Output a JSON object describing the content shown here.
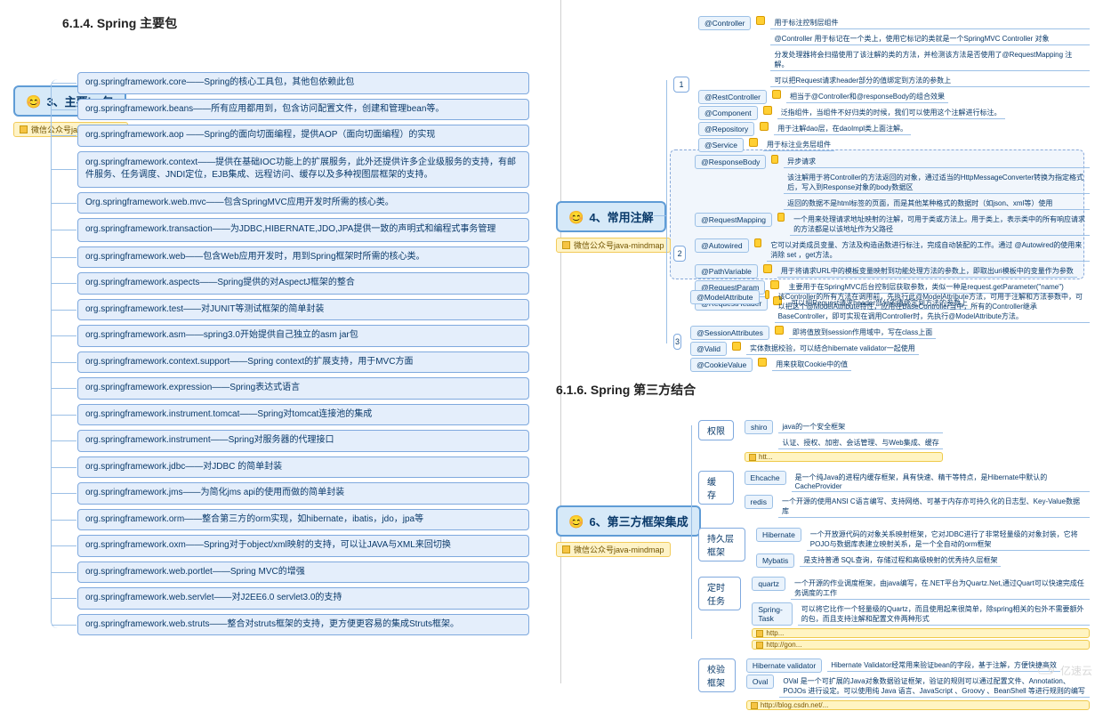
{
  "headings": {
    "h614": "6.1.4.  Spring 主要包",
    "h616": "6.1.6.  Spring 第三方结合"
  },
  "left": {
    "root": "3、主要jar包",
    "caption": "微信公众号java-mindmap",
    "items": [
      "org.springframework.core——Spring的核心工具包，其他包依赖此包",
      "org.springframework.beans——所有应用都用到，包含访问配置文件，创建和管理bean等。",
      "org.springframework.aop ——Spring的面向切面编程，提供AOP（面向切面编程）的实现",
      "org.springframework.context——提供在基础IOC功能上的扩展服务，此外还提供许多企业级服务的支持，有邮件服务、任务调度、JNDI定位，EJB集成、远程访问、缓存以及多种视图层框架的支持。",
      "Org.springframework.web.mvc——包含SpringMVC应用开发时所需的核心类。",
      "org.springframework.transaction——为JDBC,HIBERNATE,JDO,JPA提供一致的声明式和编程式事务管理",
      "org.springframework.web——包含Web应用开发时，用到Spring框架时所需的核心类。",
      "org.springframework.aspects——Spring提供的对AspectJ框架的整合",
      "org.springframework.test——对JUNIT等测试框架的简单封装",
      "org.springframework.asm——spring3.0开始提供自己独立的asm jar包",
      "org.springframework.context.support——Spring context的扩展支持，用于MVC方面",
      "org.springframework.expression——Spring表达式语言",
      "org.springframework.instrument.tomcat——Spring对tomcat连接池的集成",
      "org.springframework.instrument——Spring对服务器的代理接口",
      "org.springframework.jdbc——对JDBC 的简单封装",
      "org.springframework.jms——为简化jms api的使用而做的简单封装",
      "org.springframework.orm——整合第三方的orm实现，如hibernate，ibatis，jdo，jpa等",
      "org.springframework.oxm——Spring对于object/xml映射的支持，可以让JAVA与XML来回切换",
      "org.springframework.web.portlet——Spring MVC的增强",
      "org.springframework.web.servlet——对J2EE6.0 servlet3.0的支持",
      "org.springframework.web.struts——整合对struts框架的支持，更方便更容易的集成Struts框架。"
    ]
  },
  "ann": {
    "root": "4、常用注解",
    "caption": "微信公众号java-mindmap",
    "group1": {
      "num": "1",
      "rows": [
        {
          "k": "@Controller",
          "v": [
            "用于标注控制层组件",
            "@Controller 用于标记在一个类上，使用它标记的类就是一个SpringMVC Controller 对象",
            "分发处理器将会扫描使用了该注解的类的方法，并检测该方法是否使用了@RequestMapping 注解。",
            "可以把Request请求header部分的值绑定到方法的参数上"
          ]
        },
        {
          "k": "@RestController",
          "v": [
            "相当于@Controller和@responseBody的组合效果"
          ]
        },
        {
          "k": "@Component",
          "v": [
            "泛指组件，当组件不好归类的时候，我们可以使用这个注解进行标注。"
          ]
        },
        {
          "k": "@Repository",
          "v": [
            "用于注解dao层，在daoImpl类上面注解。"
          ]
        },
        {
          "k": "@Service",
          "v": [
            "用于标注业务层组件"
          ]
        }
      ]
    },
    "group2": {
      "num": "2",
      "rows": [
        {
          "k": "@ResponseBody",
          "v": [
            "异步请求",
            "该注解用于将Controller的方法返回的对象，通过适当的HttpMessageConverter转换为指定格式后，写入到Response对象的body数据区",
            "返回的数据不是html标签的页面，而是其他某种格式的数据时（如json、xml等）使用"
          ]
        },
        {
          "k": "@RequestMapping",
          "v": [
            "一个用来处理请求地址映射的注解，可用于类或方法上。用于类上，表示类中的所有响应请求的方法都是以该地址作为父路径"
          ]
        },
        {
          "k": "@Autowired",
          "v": [
            "它可以对类成员变量、方法及构造函数进行标注，完成自动装配的工作。通过 @Autowired的使用来消除 set ，get方法。"
          ]
        },
        {
          "k": "@PathVariable",
          "v": [
            "用于将请求URL中的模板变量映射到功能处理方法的参数上，即取出uri模板中的变量作为参数"
          ]
        },
        {
          "k": "@RequestParam",
          "v": [
            "主要用于在SpringMVC后台控制层获取参数，类似一种是request.getParameter(\"name\")"
          ]
        },
        {
          "k": "@RequestHeader",
          "v": [
            "可以把Request请求header部分的值绑定到方法的参数上"
          ]
        }
      ]
    },
    "group3": {
      "num": "3",
      "rows": [
        {
          "k": "@ModelAttribute",
          "v": [
            "该Controller的所有方法在调用前，先执行此@ModelAttribute方法，可用于注解和方法参数中，可以把这个@ModelAttribute特性，应用在BaseController当中，所有的Controller继承BaseController，即可实现在调用Controller时，先执行@ModelAttribute方法。"
          ]
        },
        {
          "k": "@SessionAttributes",
          "v": [
            "即将值放到session作用域中，写在class上面"
          ]
        },
        {
          "k": "@Valid",
          "v": [
            "实体数据校验，可以结合hibernate validator一起使用"
          ]
        },
        {
          "k": "@CookieValue",
          "v": [
            "用来获取Cookie中的值"
          ]
        }
      ]
    }
  },
  "tp": {
    "root": "6、第三方框架集成",
    "caption": "微信公众号java-mindmap",
    "cats": [
      {
        "name": "权限",
        "items": [
          {
            "k": "shiro",
            "v": "java的一个安全框架",
            "sub": "认证、授权、加密、会话管理、与Web集成、缓存"
          }
        ],
        "tags": [
          "htt..."
        ]
      },
      {
        "name": "缓存",
        "items": [
          {
            "k": "Ehcache",
            "v": "是一个纯Java的进程内缓存框架，具有快速、精干等特点，是Hibernate中默认的CacheProvider"
          },
          {
            "k": "redis",
            "v": "一个开源的使用ANSI C语言编写、支持网络、可基于内存亦可持久化的日志型、Key-Value数据库"
          }
        ]
      },
      {
        "name": "持久层框架",
        "items": [
          {
            "k": "Hibernate",
            "v": "一个开放源代码的对象关系映射框架，它对JDBC进行了非常轻量级的对象封装，它将POJO与数据库表建立映射关系，是一个全自动的orm框架"
          },
          {
            "k": "Mybatis",
            "v": "是支持普通 SQL查询，存储过程和高级映射的优秀持久层框架"
          }
        ]
      },
      {
        "name": "定时任务",
        "items": [
          {
            "k": "quartz",
            "v": "一个开源的作业调度框架，由java编写，在.NET平台为Quartz.Net,通过Quart可以快速完成任务调度的工作"
          },
          {
            "k": "Spring-Task",
            "v": "可以将它比作一个轻量级的Quartz，而且使用起来很简单，除spring相关的包外不需要额外的包，而且支持注解和配置文件两种形式"
          }
        ],
        "tags": [
          "http...",
          "http://gon..."
        ]
      },
      {
        "name": "校验框架",
        "items": [
          {
            "k": "Hibernate validator",
            "v": "Hibernate Validator经常用来验证bean的字段，基于注解，方便快捷高效"
          },
          {
            "k": "Oval",
            "v": "OVal 是一个可扩展的Java对象数据验证框架，验证的规则可以通过配置文件、Annotation、POJOs 进行设定。可以使用纯 Java 语言、JavaScript 、Groovy 、BeanShell 等进行规则的编写"
          }
        ],
        "tags": [
          "http://blog.csdn.net/..."
        ]
      }
    ]
  },
  "watermark": "亿速云"
}
